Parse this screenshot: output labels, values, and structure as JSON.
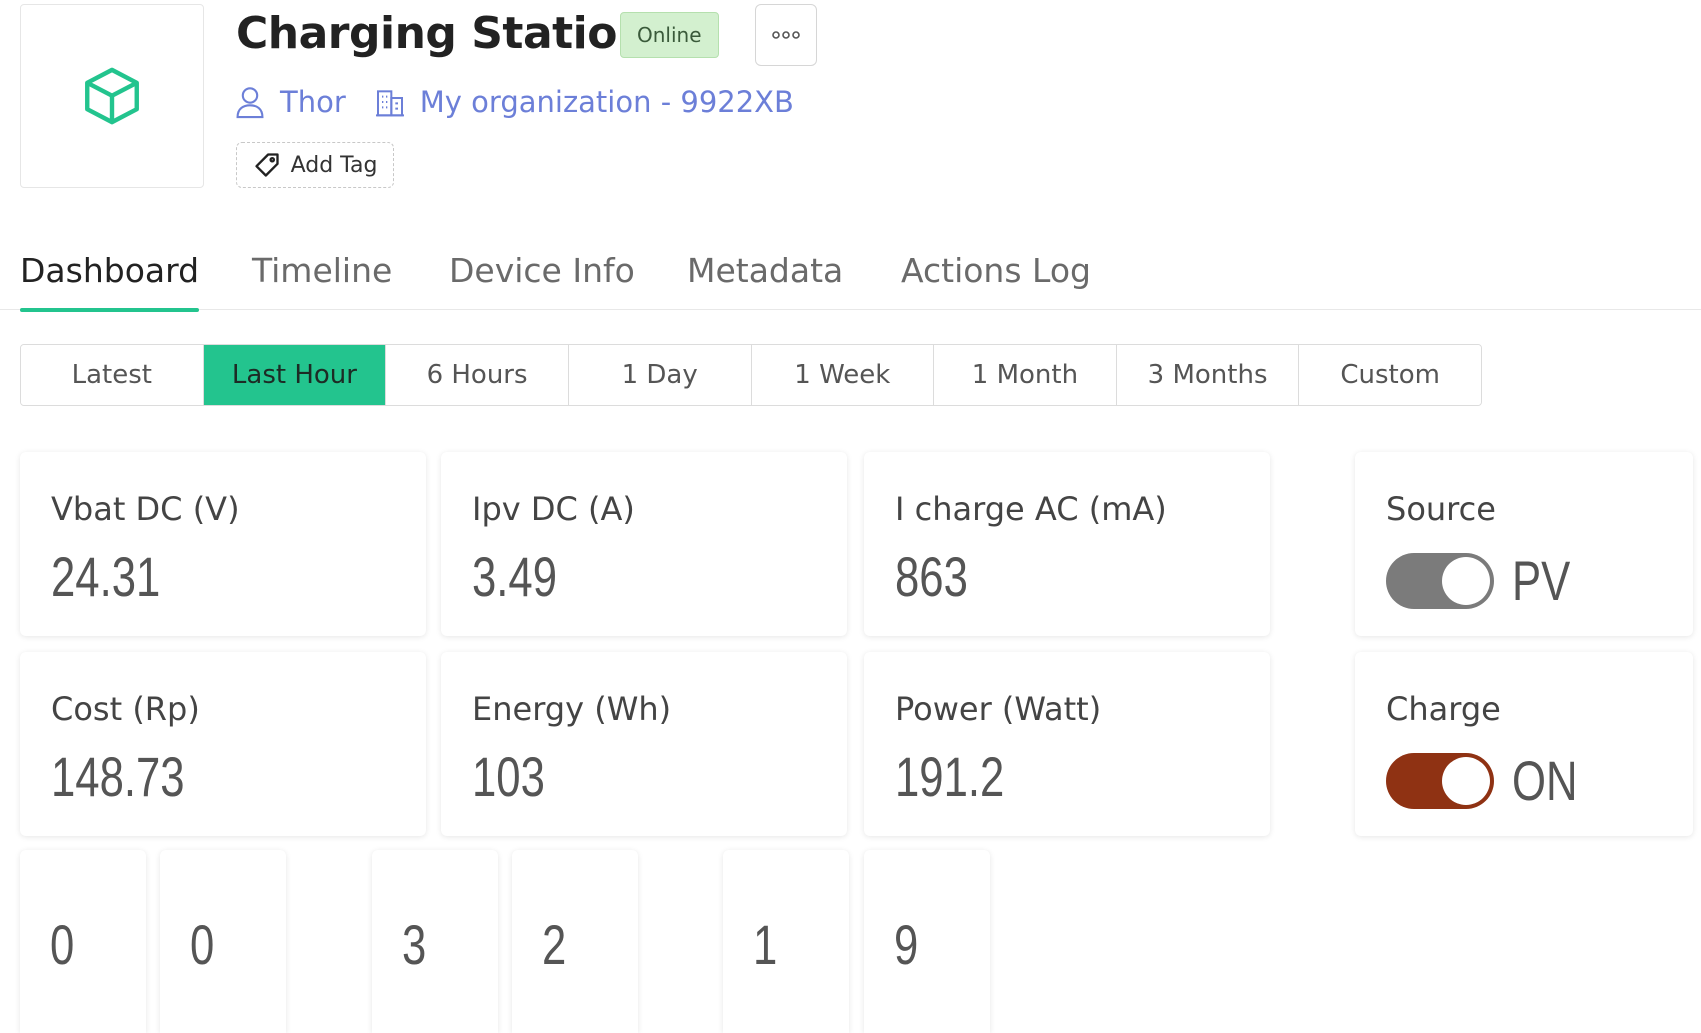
{
  "header": {
    "title": "Charging Station",
    "status": "Online",
    "owner": "Thor",
    "organization": "My organization - 9922XB",
    "add_tag_label": "Add Tag",
    "icons": {
      "device": "cube-icon",
      "more": "more-dots-icon",
      "owner": "user-icon",
      "organization": "building-icon",
      "tag": "tag-icon"
    }
  },
  "tabs": [
    {
      "label": "Dashboard",
      "active": true
    },
    {
      "label": "Timeline",
      "active": false
    },
    {
      "label": "Device Info",
      "active": false
    },
    {
      "label": "Metadata",
      "active": false
    },
    {
      "label": "Actions Log",
      "active": false
    }
  ],
  "time_range": {
    "options": [
      "Latest",
      "Last Hour",
      "6 Hours",
      "1 Day",
      "1 Week",
      "1 Month",
      "3 Months",
      "Custom"
    ],
    "selected": "Last Hour"
  },
  "widgets": {
    "vbat": {
      "label": "Vbat DC (V)",
      "value": "24.31"
    },
    "ipv": {
      "label": "Ipv DC (A)",
      "value": "3.49"
    },
    "icharge": {
      "label": "I charge AC (mA)",
      "value": "863"
    },
    "cost": {
      "label": "Cost (Rp)",
      "value": "148.73"
    },
    "energy": {
      "label": "Energy (Wh)",
      "value": "103"
    },
    "power": {
      "label": "Power (Watt)",
      "value": "191.2"
    },
    "source": {
      "label": "Source",
      "state_text": "PV",
      "on": true,
      "color": "#7b7b7b"
    },
    "charge": {
      "label": "Charge",
      "state_text": "ON",
      "on": true,
      "color": "#8f3213"
    }
  },
  "digits": [
    "0",
    "0",
    "3",
    "2",
    "1",
    "9"
  ],
  "colors": {
    "accent": "#23c48e",
    "link": "#6c7fd8",
    "badge_bg": "#d3f0cf"
  }
}
